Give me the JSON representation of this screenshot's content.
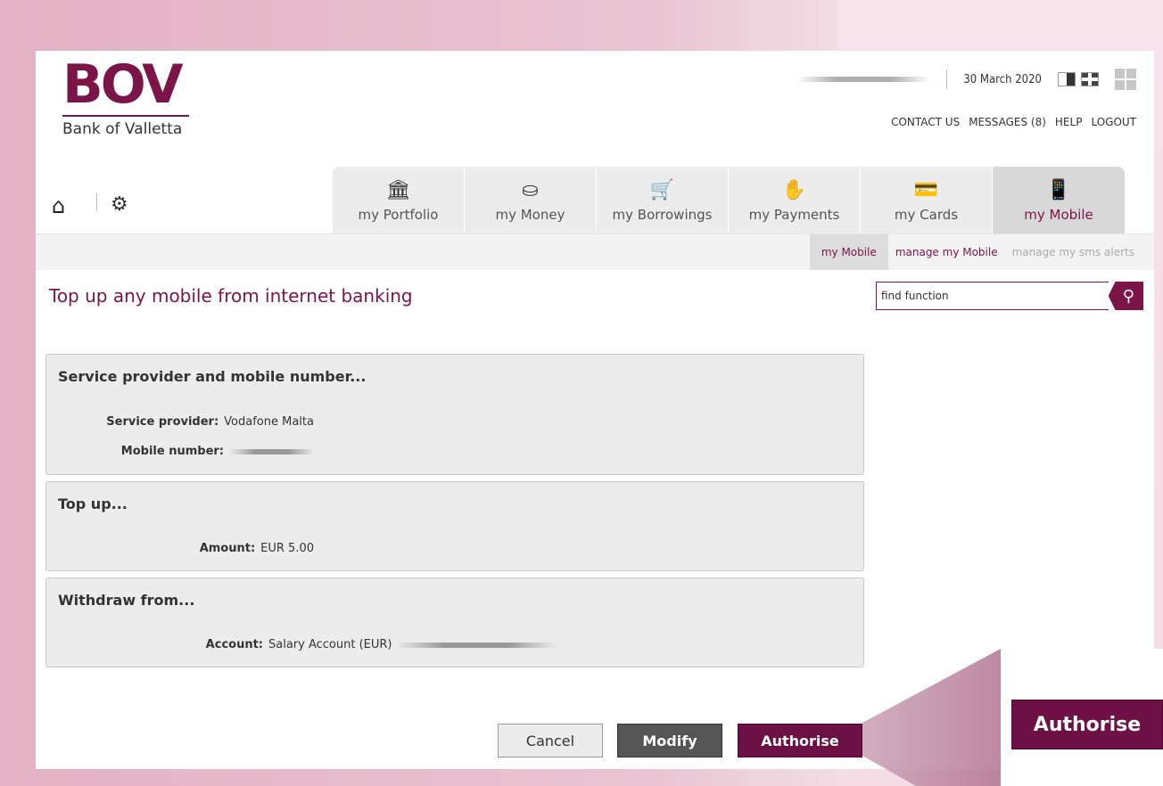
{
  "brand": {
    "logo": "BOV",
    "subtitle": "Bank of Valletta"
  },
  "header": {
    "date": "30 March 2020",
    "links": [
      "CONTACT US",
      "MESSAGES (8)",
      "HELP",
      "LOGOUT"
    ]
  },
  "tabs": [
    {
      "label": "my Portfolio",
      "icon": "bank-icon",
      "glyph": "🏛"
    },
    {
      "label": "my Money",
      "icon": "coins-icon",
      "glyph": "🪙"
    },
    {
      "label": "my Borrowings",
      "icon": "cart-icon",
      "glyph": "🛒"
    },
    {
      "label": "my Payments",
      "icon": "payment-hand-icon",
      "glyph": "✋"
    },
    {
      "label": "my Cards",
      "icon": "cards-icon",
      "glyph": "💳"
    },
    {
      "label": "my Mobile",
      "icon": "mobile-icon",
      "glyph": "📱"
    }
  ],
  "subtabs": [
    "my Mobile",
    "manage my Mobile",
    "manage my sms alerts"
  ],
  "page": {
    "title": "Top up any mobile from internet banking"
  },
  "search": {
    "placeholder": "find function",
    "value": "find function"
  },
  "panels": {
    "provider": {
      "heading": "Service provider and mobile number...",
      "service_provider_label": "Service provider:",
      "service_provider_value": "Vodafone Malta",
      "mobile_label": "Mobile number:"
    },
    "topup": {
      "heading": "Top up...",
      "amount_label": "Amount:",
      "amount_value": "EUR 5.00"
    },
    "withdraw": {
      "heading": "Withdraw from...",
      "account_label": "Account:",
      "account_value": "Salary Account (EUR)"
    }
  },
  "buttons": {
    "cancel": "Cancel",
    "modify": "Modify",
    "authorise": "Authorise"
  },
  "colors": {
    "brand": "#7b1447",
    "panel": "#ececec"
  }
}
